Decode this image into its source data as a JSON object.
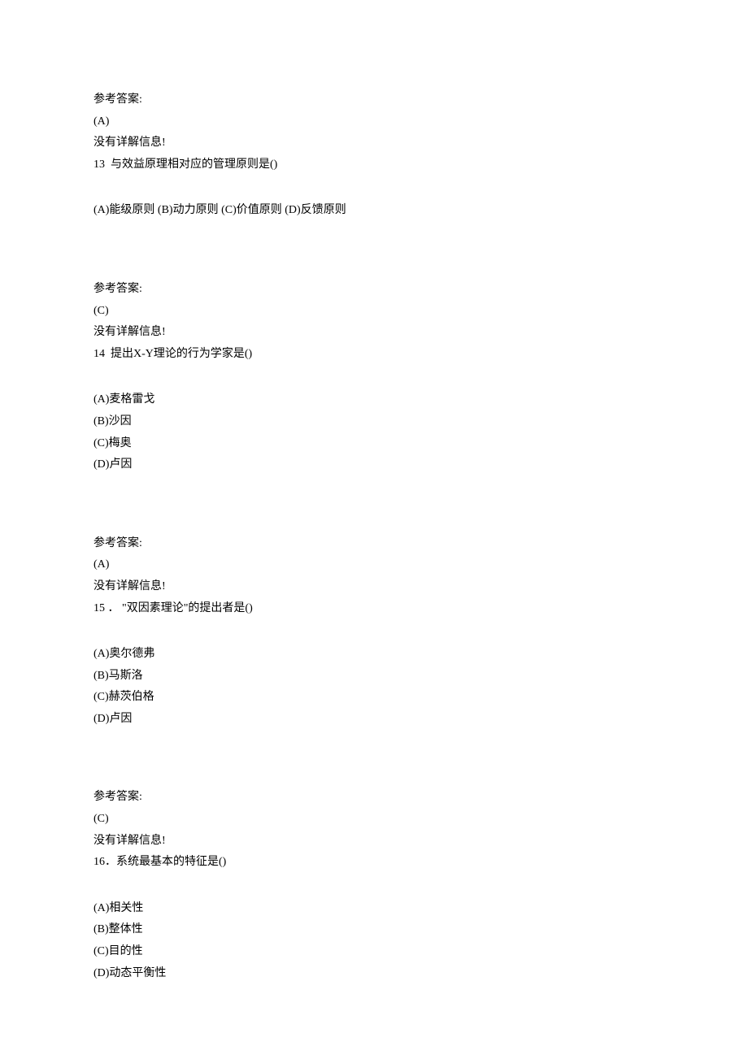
{
  "labels": {
    "answer_header": "参考答案:",
    "no_detail": "没有详解信息!"
  },
  "questions": [
    {
      "pre_answer": "(A)",
      "number": "13",
      "spacer": "  ",
      "stem": "与效益原理相对应的管理原则是()",
      "options_inline": "(A)能级原则 (B)动力原则 (C)价值原则 (D)反馈原则",
      "options_list": null,
      "post_answer": "(C)"
    },
    {
      "pre_answer": "(C)",
      "number": "14",
      "spacer": "  ",
      "stem": "提出X-Y理论的行为学家是()",
      "options_inline": null,
      "options_list": [
        "(A)麦格雷戈",
        "(B)沙因",
        "(C)梅奥",
        "(D)卢因"
      ],
      "post_answer": "(A)"
    },
    {
      "pre_answer": "(A)",
      "number": "15",
      "spacer": " ． ",
      "stem": "\"双因素理论\"的提出者是()",
      "options_inline": null,
      "options_list": [
        "(A)奥尔德弗",
        "(B)马斯洛",
        "(C)赫茨伯格",
        "(D)卢因"
      ],
      "post_answer": "(C)"
    },
    {
      "pre_answer": "(C)",
      "number": "16",
      "spacer": "．",
      "stem": "系统最基本的特征是()",
      "options_inline": null,
      "options_list": [
        "(A)相关性",
        "(B)整体性",
        "(C)目的性",
        "(D)动态平衡性"
      ],
      "post_answer": null
    }
  ]
}
